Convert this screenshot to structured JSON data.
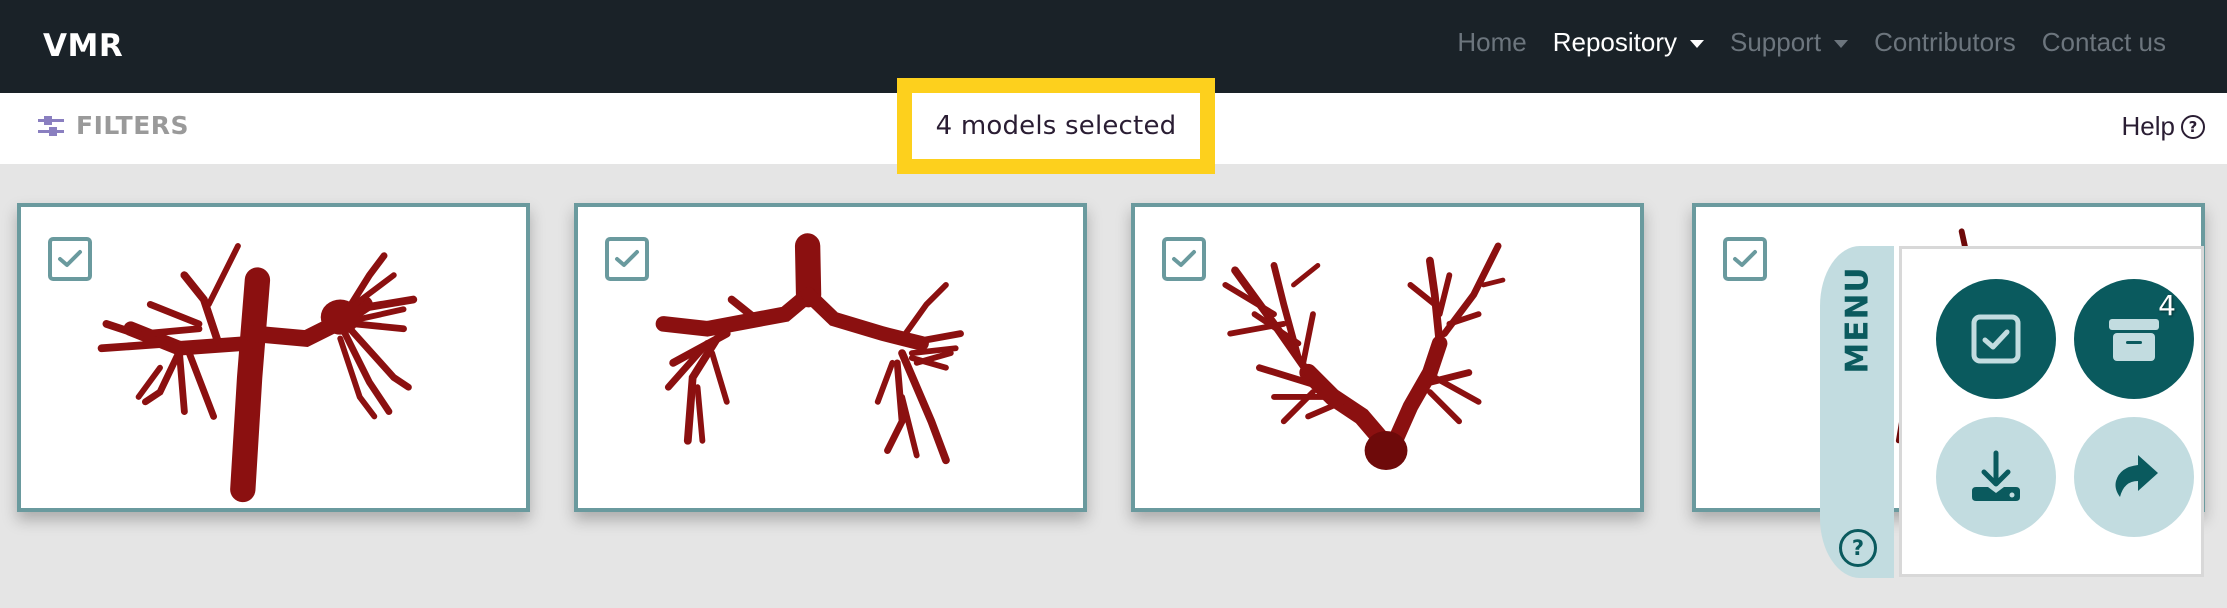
{
  "navbar": {
    "brand": "VMR",
    "items": [
      {
        "label": "Home",
        "active": false,
        "dropdown": false
      },
      {
        "label": "Repository",
        "active": true,
        "dropdown": true
      },
      {
        "label": "Support",
        "active": false,
        "dropdown": true
      },
      {
        "label": "Contributors",
        "active": false,
        "dropdown": false
      },
      {
        "label": "Contact us",
        "active": false,
        "dropdown": false
      }
    ]
  },
  "filterbar": {
    "filters_label": "FILTERS",
    "filters_icon": "sliders-icon",
    "selection_status": "4 models selected",
    "help_label": "Help",
    "help_icon": "question-circle-icon",
    "help_icon_glyph": "?"
  },
  "models": [
    {
      "name": "model-1",
      "selected": true,
      "image": "vascular model: aorta with branching pulmonary arteries"
    },
    {
      "name": "model-2",
      "selected": true,
      "image": "vascular model: pulmonary artery tree"
    },
    {
      "name": "model-3",
      "selected": true,
      "image": "vascular model: V-shaped branching arterial tree"
    },
    {
      "name": "model-4",
      "selected": true,
      "image": "vascular model (partially hidden by menu)"
    }
  ],
  "menu": {
    "tab_label": "MENU",
    "help_glyph": "?",
    "buttons": [
      {
        "name": "select-all",
        "icon": "checkbox-checked-icon",
        "style": "dark"
      },
      {
        "name": "selected-archive",
        "icon": "archive-box-icon",
        "style": "dark",
        "badge": "4"
      },
      {
        "name": "download",
        "icon": "download-tray-icon",
        "style": "light"
      },
      {
        "name": "share",
        "icon": "share-arrow-icon",
        "style": "light"
      }
    ]
  },
  "colors": {
    "navbar_bg": "#1a2228",
    "highlight_yellow": "#fdd01d",
    "teal_dark": "#0a5a5e",
    "teal_light": "#c2dce0",
    "card_border": "#6a9a9e",
    "vessel_red": "#8b1010",
    "filters_icon": "#8a7fc0"
  }
}
